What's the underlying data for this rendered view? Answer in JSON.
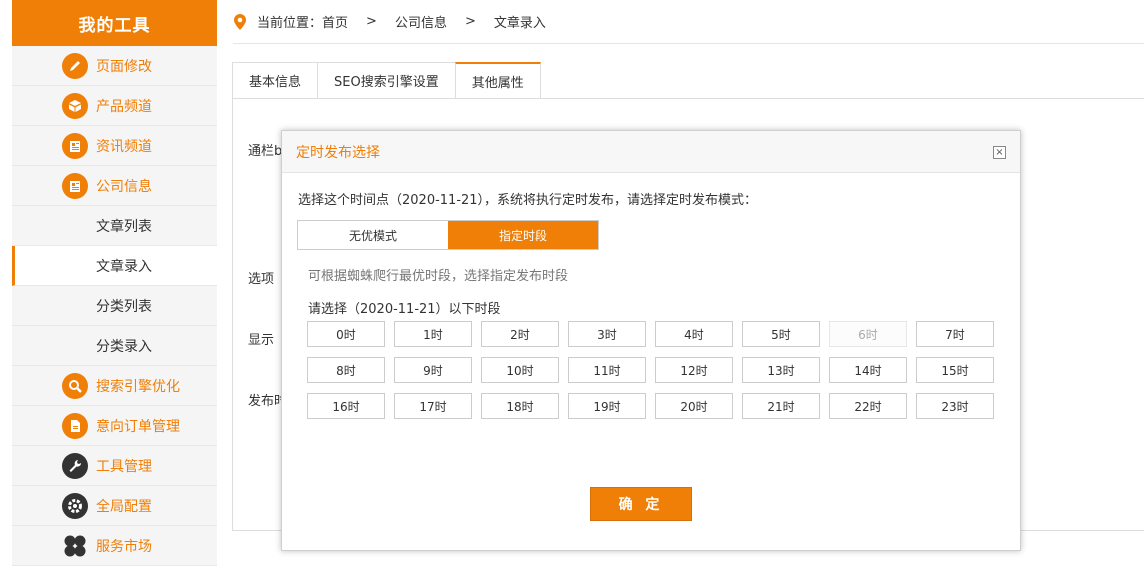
{
  "sidebar": {
    "title": "我的工具",
    "items": [
      {
        "label": "页面修改",
        "icon": "pencil-icon"
      },
      {
        "label": "产品频道",
        "icon": "box-icon"
      },
      {
        "label": "资讯频道",
        "icon": "news-icon"
      },
      {
        "label": "公司信息",
        "icon": "news-icon"
      },
      {
        "label": "文章列表"
      },
      {
        "label": "文章录入"
      },
      {
        "label": "分类列表"
      },
      {
        "label": "分类录入"
      },
      {
        "label": "搜索引擎优化",
        "icon": "search-icon"
      },
      {
        "label": "意向订单管理",
        "icon": "document-icon"
      },
      {
        "label": "工具管理",
        "icon": "wrench-icon"
      },
      {
        "label": "全局配置",
        "icon": "gear-icon"
      },
      {
        "label": "服务市场",
        "icon": "clover-icon"
      }
    ]
  },
  "breadcrumb": {
    "prefix": "当前位置：",
    "items": [
      "首页",
      "公司信息",
      "文章录入"
    ],
    "separator": ">"
  },
  "tabs": [
    "基本信息",
    "SEO搜索引擎设置",
    "其他属性"
  ],
  "form_labels": [
    "通栏ba",
    "选项",
    "显示",
    "发布时"
  ],
  "modal": {
    "title": "定时发布选择",
    "close": "×",
    "description": "选择这个时间点（2020-11-21），系统将执行定时发布，请选择定时发布模式：",
    "modes": [
      "无优模式",
      "指定时段"
    ],
    "hint": "可根据蜘蛛爬行最优时段，选择指定发布时段",
    "select_label": "请选择（2020-11-21）以下时段",
    "hours": [
      "0时",
      "1时",
      "2时",
      "3时",
      "4时",
      "5时",
      "6时",
      "7时",
      "8时",
      "9时",
      "10时",
      "11时",
      "12时",
      "13时",
      "14时",
      "15时",
      "16时",
      "17时",
      "18时",
      "19时",
      "20时",
      "21时",
      "22时",
      "23时"
    ],
    "disabled_hour": "6时",
    "confirm": "确 定"
  },
  "colors": {
    "accent": "#ef7f07"
  }
}
